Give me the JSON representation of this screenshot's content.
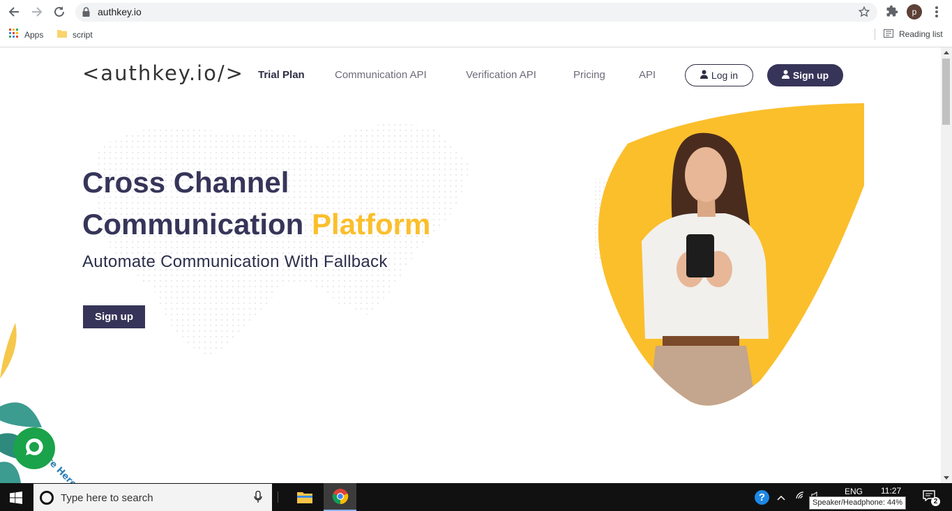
{
  "browser": {
    "url": "authkey.io",
    "profile_initial": "p",
    "bookmarks": [
      {
        "label": "Apps"
      },
      {
        "label": "script"
      }
    ],
    "reading_list_label": "Reading list"
  },
  "site": {
    "logo": "<authkey.io/>",
    "nav": [
      {
        "label": "Trial Plan"
      },
      {
        "label": "Communication API"
      },
      {
        "label": "Verification API"
      },
      {
        "label": "Pricing"
      },
      {
        "label": "API"
      }
    ],
    "login_label": "Log in",
    "signup_label": "Sign up",
    "hero": {
      "title_line1": "Cross Channel",
      "title_line2_plain": "Communication ",
      "title_line2_highlight": "Platform",
      "subtitle": "Automate Communication With Fallback",
      "cta_label": "Sign up"
    },
    "chat_widget": {
      "badge_text": "We Are Here!"
    },
    "colors": {
      "brand_dark": "#363559",
      "accent_yellow": "#fbbf2c",
      "chat_green": "#1aa34a"
    }
  },
  "taskbar": {
    "search_placeholder": "Type here to search",
    "language": "ENG",
    "time": "11:27",
    "tooltip": "Speaker/Headphone: 44%",
    "notifications_count": "2"
  }
}
